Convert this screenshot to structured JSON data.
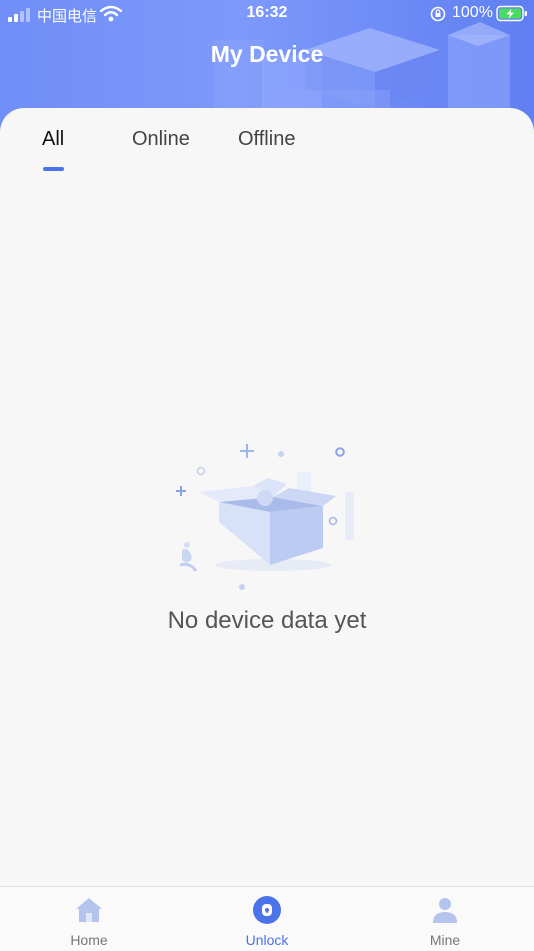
{
  "status_bar": {
    "carrier": "中国电信",
    "time": "16:32",
    "battery_percent": "100%"
  },
  "header": {
    "title": "My Device"
  },
  "tabs": [
    {
      "label": "All",
      "selected": true
    },
    {
      "label": "Online",
      "selected": false
    },
    {
      "label": "Offline",
      "selected": false
    }
  ],
  "empty_state": {
    "message": "No device data yet"
  },
  "bottom_nav": [
    {
      "label": "Home",
      "icon": "home-icon",
      "active": false
    },
    {
      "label": "Unlock",
      "icon": "unlock-icon",
      "active": true
    },
    {
      "label": "Mine",
      "icon": "user-icon",
      "active": false
    }
  ],
  "colors": {
    "header_gradient_start": "#6f8ef7",
    "header_gradient_end": "#5f7ff2",
    "accent": "#4b73ea",
    "page_bg": "#f7f7f7"
  }
}
